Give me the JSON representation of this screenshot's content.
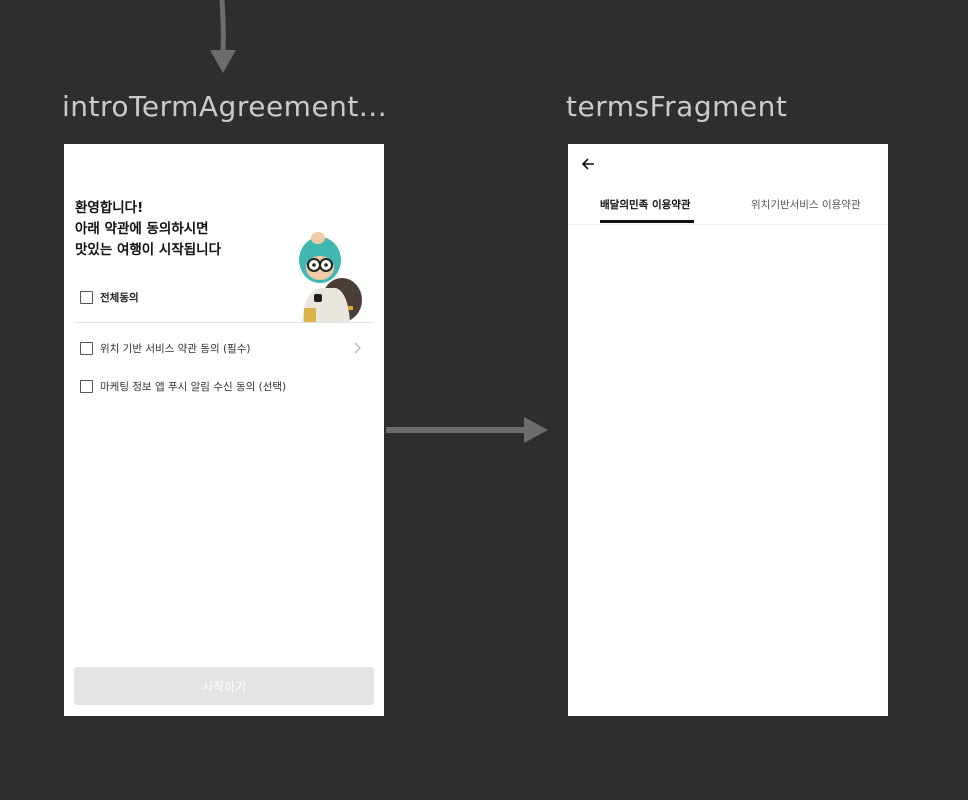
{
  "labels": {
    "left_screen": "introTermAgreement...",
    "right_screen": "termsFragment"
  },
  "intro": {
    "welcome_lines": [
      "환영합니다!",
      "아래 약관에 동의하시면",
      "맛있는 여행이 시작됩니다"
    ],
    "agree_all": "전체동의",
    "terms": [
      {
        "label": "위치 기반 서비스 약관 동의 (필수)",
        "has_detail": true
      },
      {
        "label": "마케팅 정보 앱 푸시 알림 수신 동의 (선택)",
        "has_detail": false
      }
    ],
    "start_button": "시작하기"
  },
  "terms_screen": {
    "tabs": [
      {
        "label": "배달의민족 이용약관",
        "selected": true
      },
      {
        "label": "위치기반서비스 이용약관",
        "selected": false
      }
    ]
  },
  "colors": {
    "background": "#2d2e30",
    "screen": "#ffffff",
    "connector": "#6b6c6e",
    "disabled_button": "#e4e4e4",
    "tab_indicator": "#111111"
  },
  "icons": {
    "back": "arrow-left-icon",
    "detail": "chevron-right-icon"
  }
}
